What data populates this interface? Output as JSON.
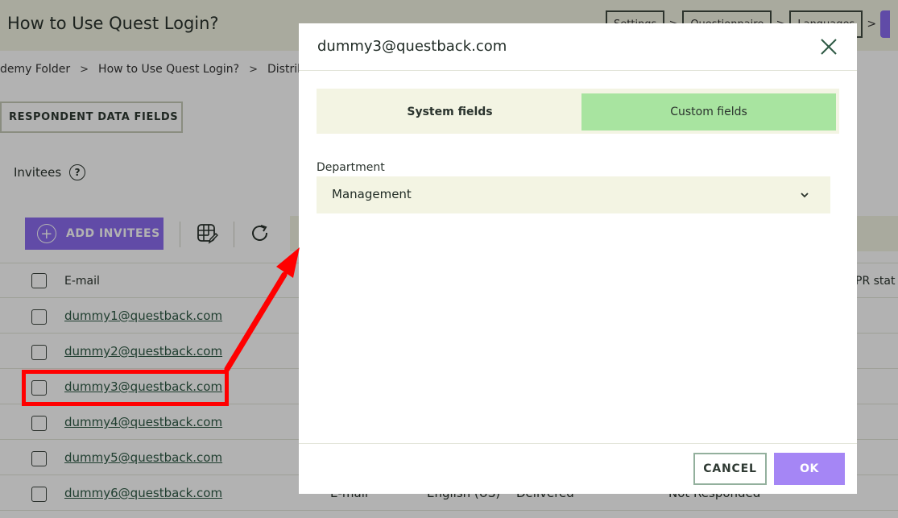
{
  "page": {
    "title": "How to Use Quest Login?",
    "steps": [
      "Settings",
      "Questionnaire",
      "Languages"
    ]
  },
  "breadcrumb": [
    "demy Folder",
    "How to Use Quest Login?",
    "Distributio"
  ],
  "respondent_data_fields_label": "RESPONDENT DATA FIELDS",
  "invitees": {
    "label": "Invitees",
    "help_glyph": "?",
    "add_label": "ADD INVITEES",
    "header_email": "E-mail",
    "header_status": "PR stat",
    "rows": [
      {
        "email": "dummy1@questback.com"
      },
      {
        "email": "dummy2@questback.com"
      },
      {
        "email": "dummy3@questback.com"
      },
      {
        "email": "dummy4@questback.com"
      },
      {
        "email": "dummy5@questback.com"
      },
      {
        "email": "dummy6@questback.com",
        "type": "E-mail",
        "language": "English (US)",
        "delivery": "Delivered",
        "response": "Not Responded"
      }
    ]
  },
  "modal": {
    "title": "dummy3@questback.com",
    "tabs": [
      {
        "label": "System fields",
        "active": false
      },
      {
        "label": "Custom fields",
        "active": true
      }
    ],
    "field_label": "Department",
    "field_value": "Management",
    "cancel_label": "CANCEL",
    "ok_label": "OK"
  },
  "colors": {
    "accent_purple": "#8b6cf0",
    "active_tab_green": "#a8e4a0",
    "surface_cream": "#f3f4e3",
    "annotation_red": "#ff0000"
  }
}
